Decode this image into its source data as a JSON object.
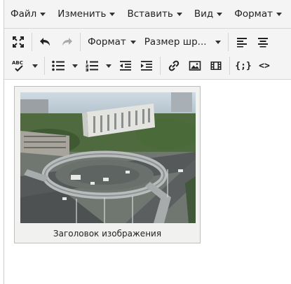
{
  "menubar": {
    "items": [
      {
        "label": "Файл"
      },
      {
        "label": "Изменить"
      },
      {
        "label": "Вставить"
      },
      {
        "label": "Вид"
      },
      {
        "label": "Формат"
      }
    ]
  },
  "toolbar": {
    "format_label": "Формат",
    "font_size_label": "Размер шр...",
    "spellcheck_label": "ABC",
    "code_label": "{;}",
    "source_label": "<>"
  },
  "icons": {
    "fullscreen": "fullscreen-icon",
    "undo": "undo-icon",
    "redo": "redo-icon",
    "align_left": "align-left-icon",
    "align_center": "align-center-icon",
    "spellcheck": "spellcheck-icon",
    "bullet_list": "bullet-list-icon",
    "numbered_list": "numbered-list-icon",
    "outdent": "outdent-icon",
    "indent": "indent-icon",
    "link": "link-icon",
    "image": "image-icon",
    "media": "media-icon",
    "code_sample": "code-sample-icon",
    "source_code": "source-code-icon"
  },
  "content": {
    "image_caption": "Заголовок изображения"
  },
  "colors": {
    "toolbar_bg": "#f4f4f4",
    "border": "#d6d6d6",
    "icon": "#222222",
    "figure_bg": "#f1f1ef"
  }
}
